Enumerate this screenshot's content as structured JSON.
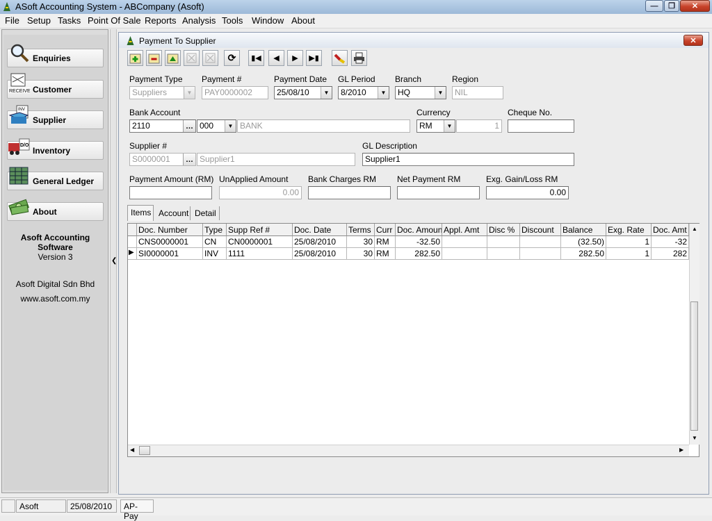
{
  "window": {
    "title": "ASoft Accounting System - ABCompany (Asoft)"
  },
  "menu": [
    "File",
    "Setup",
    "Tasks",
    "Point Of Sale",
    "Reports",
    "Analysis",
    "Tools",
    "Window",
    "About"
  ],
  "nav": {
    "items": [
      {
        "label": "Enquiries",
        "icon": "magnifier-icon"
      },
      {
        "label": "Customer",
        "icon": "received-stamp-icon"
      },
      {
        "label": "Supplier",
        "icon": "supplier-invoice-icon"
      },
      {
        "label": "Inventory",
        "icon": "delivery-order-icon"
      },
      {
        "label": "General Ledger",
        "icon": "ledger-icon"
      },
      {
        "label": "About",
        "icon": "money-icon"
      }
    ],
    "about_title": "Asoft Accounting Software",
    "about_version": "Version 3",
    "company": "Asoft Digital Sdn Bhd",
    "website": "www.asoft.com.my"
  },
  "form": {
    "title": "Payment To Supplier",
    "labels": {
      "payment_type": "Payment Type",
      "payment_no": "Payment #",
      "payment_date": "Payment Date",
      "gl_period": "GL Period",
      "branch": "Branch",
      "region": "Region",
      "bank_account": "Bank Account",
      "currency": "Currency",
      "cheque_no": "Cheque No.",
      "supplier_no": "Supplier #",
      "gl_description": "GL Description",
      "payment_amount": "Payment Amount (RM)",
      "unapplied_amount": "UnApplied Amount",
      "bank_charges": "Bank Charges RM",
      "net_payment": "Net Payment RM",
      "exg_gain_loss": "Exg. Gain/Loss RM"
    },
    "values": {
      "payment_type": "Suppliers",
      "payment_no": "PAY0000002",
      "payment_date": "25/08/10",
      "gl_period": "8/2010",
      "branch": "HQ",
      "region": "NIL",
      "bank_account": "2110",
      "bank_sub": "000",
      "bank_name": "BANK",
      "currency": "RM",
      "exchange_rate": "1",
      "cheque_no": "",
      "supplier_no": "S0000001",
      "supplier_name": "Supplier1",
      "gl_description": "Supplier1",
      "payment_amount": "",
      "unapplied_amount": "0.00",
      "bank_charges": "",
      "net_payment": "",
      "exg_gain_loss": "0.00"
    },
    "tabs": [
      "Items",
      "Account",
      "Detail"
    ],
    "grid": {
      "columns": [
        "Doc. Number",
        "Type",
        "Supp Ref #",
        "Doc. Date",
        "Terms",
        "Curr",
        "Doc. Amount",
        "Appl. Amt",
        "Disc %",
        "Discount",
        "Balance",
        "Exg. Rate",
        "Doc. Amt ("
      ],
      "rows": [
        [
          "CNS0000001",
          "CN",
          "CN0000001",
          "25/08/2010",
          "30",
          "RM",
          "-32.50",
          "",
          "",
          "",
          "(32.50)",
          "1",
          "-32"
        ],
        [
          "SI0000001",
          "INV",
          "1111",
          "25/08/2010",
          "30",
          "RM",
          "282.50",
          "",
          "",
          "",
          "282.50",
          "1",
          "282"
        ]
      ]
    }
  },
  "status": {
    "user": "Asoft",
    "date": "25/08/2010",
    "module": "AP-Pay"
  }
}
